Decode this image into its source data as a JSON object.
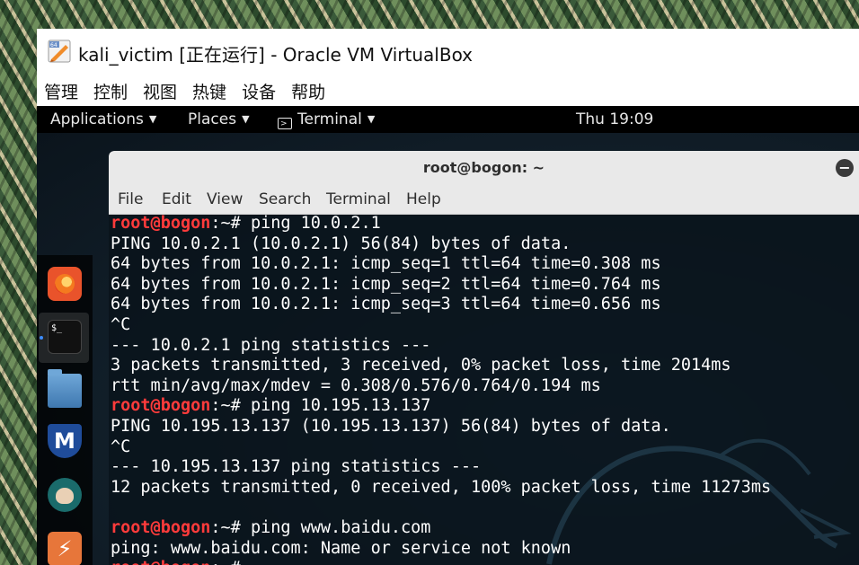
{
  "host": {
    "window_title": "kali_victim [正在运行] - Oracle VM VirtualBox",
    "menu": [
      "管理",
      "控制",
      "视图",
      "热键",
      "设备",
      "帮助"
    ]
  },
  "gnome_topbar": {
    "applications_label": "Applications",
    "places_label": "Places",
    "terminal_label": "Terminal",
    "clock": "Thu 19:09"
  },
  "dock": {
    "items": [
      "firefox-icon",
      "terminal-icon",
      "files-icon",
      "metasploit-icon",
      "armitage-icon",
      "burp-icon"
    ],
    "terminal_glyph": "$_",
    "metasploit_glyph": "M",
    "burp_glyph": "⚡"
  },
  "terminal": {
    "title": "root@bogon: ~",
    "close_glyph": "−",
    "menu": [
      "File",
      "Edit",
      "View",
      "Search",
      "Terminal",
      "Help"
    ],
    "prompt_user": "root@bogon",
    "prompt_path": ":~#",
    "lines": [
      {
        "type": "cmd",
        "text": " ping 10.0.2.1"
      },
      {
        "type": "out",
        "text": "PING 10.0.2.1 (10.0.2.1) 56(84) bytes of data."
      },
      {
        "type": "out",
        "text": "64 bytes from 10.0.2.1: icmp_seq=1 ttl=64 time=0.308 ms"
      },
      {
        "type": "out",
        "text": "64 bytes from 10.0.2.1: icmp_seq=2 ttl=64 time=0.764 ms"
      },
      {
        "type": "out",
        "text": "64 bytes from 10.0.2.1: icmp_seq=3 ttl=64 time=0.656 ms"
      },
      {
        "type": "out",
        "text": "^C"
      },
      {
        "type": "out",
        "text": "--- 10.0.2.1 ping statistics ---"
      },
      {
        "type": "out",
        "text": "3 packets transmitted, 3 received, 0% packet loss, time 2014ms"
      },
      {
        "type": "out",
        "text": "rtt min/avg/max/mdev = 0.308/0.576/0.764/0.194 ms"
      },
      {
        "type": "cmd",
        "text": " ping 10.195.13.137"
      },
      {
        "type": "out",
        "text": "PING 10.195.13.137 (10.195.13.137) 56(84) bytes of data."
      },
      {
        "type": "out",
        "text": "^C"
      },
      {
        "type": "out",
        "text": "--- 10.195.13.137 ping statistics ---"
      },
      {
        "type": "out",
        "text": "12 packets transmitted, 0 received, 100% packet loss, time 11273ms"
      },
      {
        "type": "out",
        "text": ""
      },
      {
        "type": "cmd",
        "text": " ping www.baidu.com"
      },
      {
        "type": "out",
        "text": "ping: www.baidu.com: Name or service not known"
      },
      {
        "type": "cmd",
        "text": " "
      }
    ]
  },
  "colors": {
    "prompt_user": "#ff3b3b",
    "terminal_text": "#ffffff",
    "topbar_bg": "#000000",
    "terminal_header_bg": "#e9e9e9"
  }
}
